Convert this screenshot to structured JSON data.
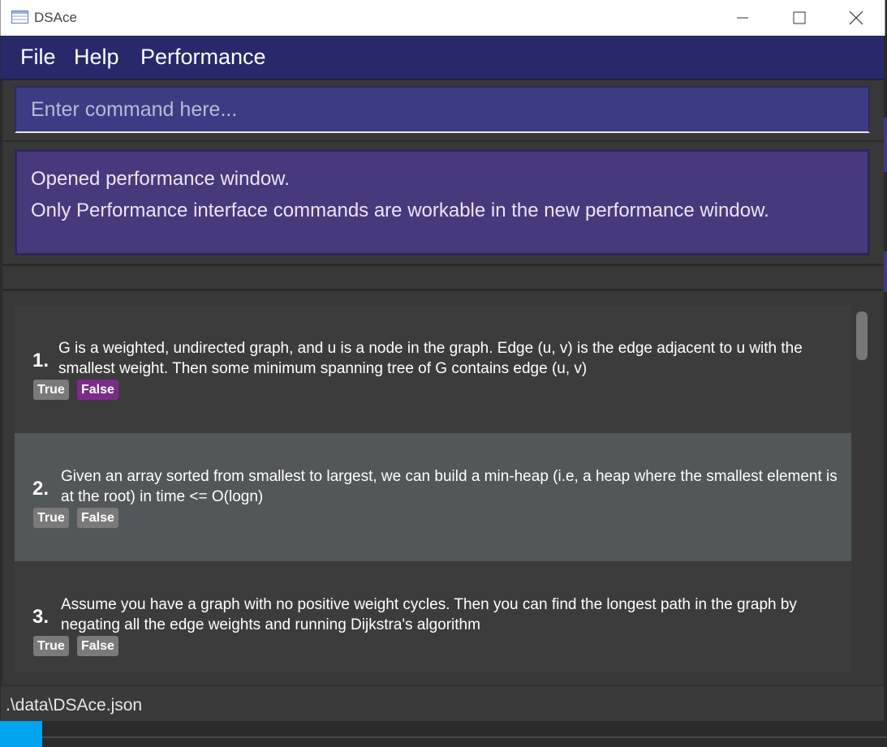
{
  "window": {
    "title": "DSAce"
  },
  "menu": {
    "items": [
      "File",
      "Help",
      "Performance"
    ]
  },
  "command": {
    "placeholder": "Enter command here..."
  },
  "result": {
    "line1": "Opened performance window.",
    "line2": "Only Performance interface commands are workable in the new performance window."
  },
  "questions": [
    {
      "number": "1.",
      "text": "G is a weighted, undirected graph, and u is a node in the graph. Edge (u, v) is the edge adjacent to u with the smallest weight. Then some minimum spanning tree of G contains edge (u, v)",
      "options": [
        "True",
        "False"
      ],
      "selected": "False",
      "bg": "#3c3c3c"
    },
    {
      "number": "2.",
      "text": "Given an array sorted from smallest to largest, we can build a min-heap (i.e, a heap where the smallest element is at the root) in time <= O(logn)",
      "options": [
        "True",
        "False"
      ],
      "selected": null,
      "bg": "#525759"
    },
    {
      "number": "3.",
      "text": "Assume you have a graph with no positive weight cycles. Then you can find the longest path in the graph by negating all the edge weights and running Dijkstra's algorithm",
      "options": [
        "True",
        "False"
      ],
      "selected": null,
      "bg": "#3c3c3c"
    }
  ],
  "status": {
    "path": ".\\data\\DSAce.json"
  },
  "colors": {
    "menubar": "#27296a",
    "command_bg": "#3b3c83",
    "result_bg": "#47397c",
    "selected_option": "#7a2d88",
    "taskbar_accent": "#00a4ef"
  },
  "icons": [
    "app-icon",
    "minimize-icon",
    "maximize-icon",
    "close-icon"
  ]
}
